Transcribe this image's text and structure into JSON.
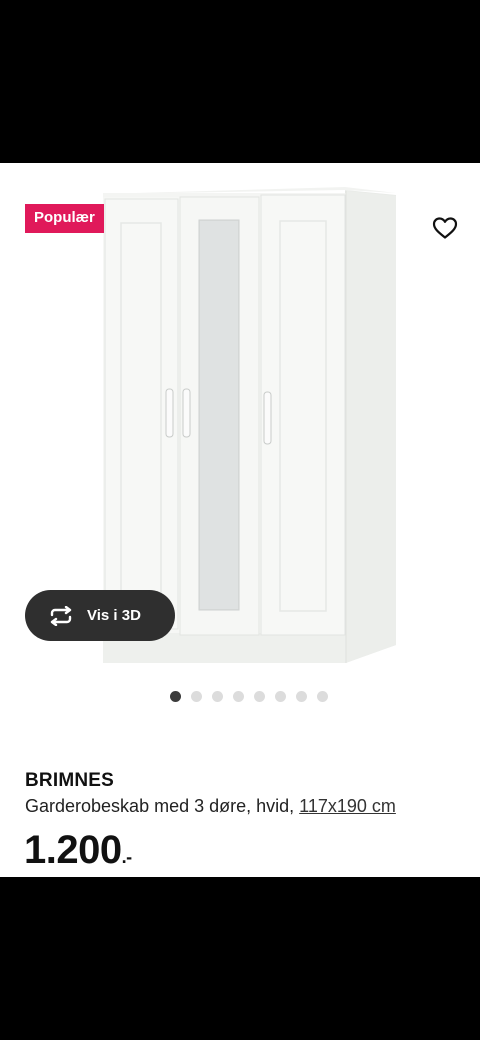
{
  "product": {
    "badge": "Populær",
    "name": "BRIMNES",
    "description": "Garderobeskab med 3 døre, hvid,",
    "dimensions": "117x190 cm",
    "price": "1.200",
    "price_suffix": ".-"
  },
  "buttons": {
    "view_3d": "Vis i 3D",
    "favorite_icon": "heart-outline-icon",
    "view_3d_icon": "rotate-arrows-icon"
  },
  "carousel": {
    "image_count": 8,
    "active_index": 0
  },
  "colors": {
    "badge": "#e0195a",
    "view3d_button": "#2f2f2f"
  }
}
